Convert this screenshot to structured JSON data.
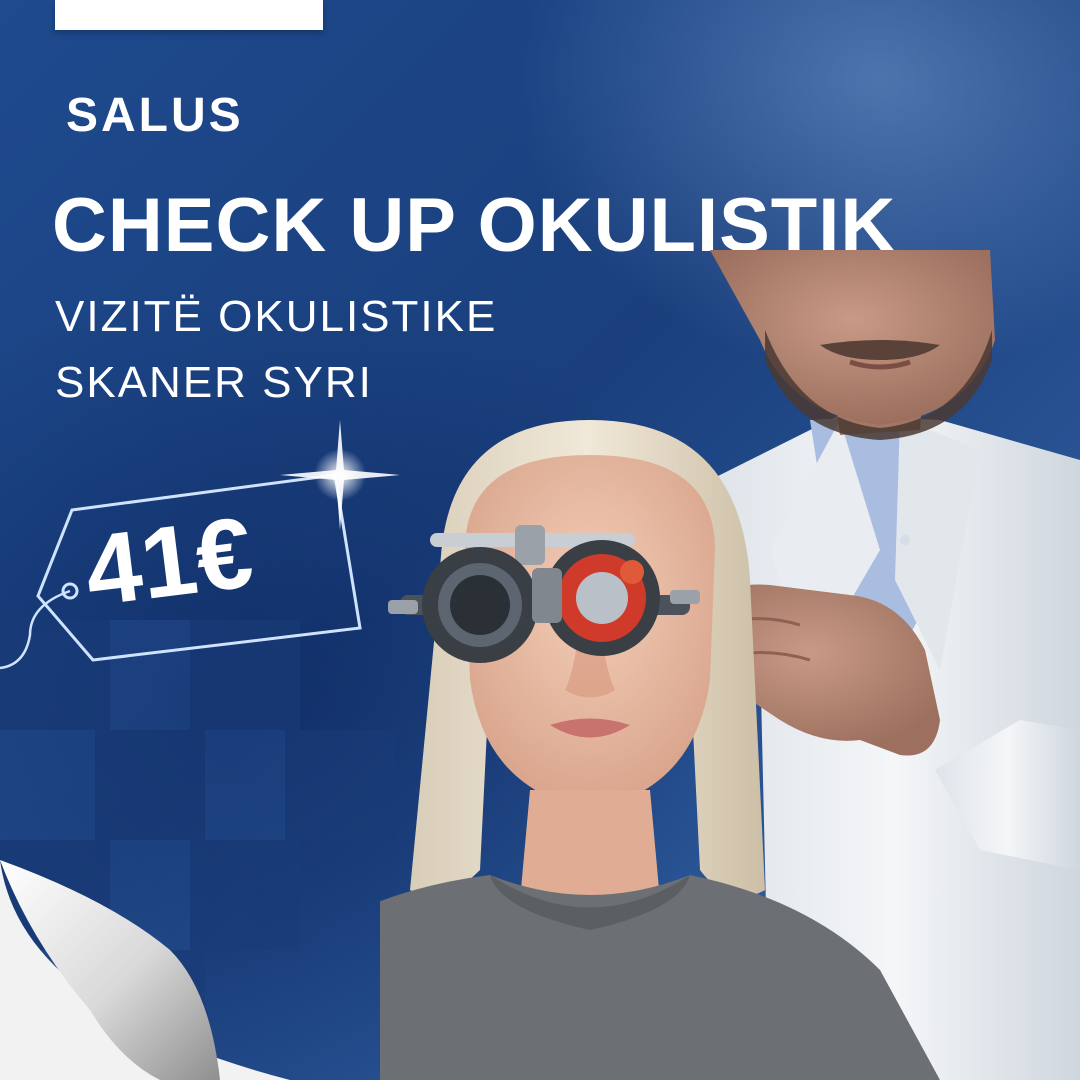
{
  "brand": {
    "name": "SALUS"
  },
  "headline": "CHECK UP OKULISTIK",
  "services": [
    "VIZITË OKULISTIKE",
    "SKANER SYRI"
  ],
  "price": {
    "amount": "41€"
  },
  "colors": {
    "background": "#1e4a8e",
    "text": "#ffffff",
    "tag_outline": "#cfe3ff"
  },
  "icons": [
    "price-tag-icon",
    "sparkle-icon",
    "page-curl-icon"
  ],
  "photo": {
    "subject": "eye-exam-trial-frame-photo"
  }
}
